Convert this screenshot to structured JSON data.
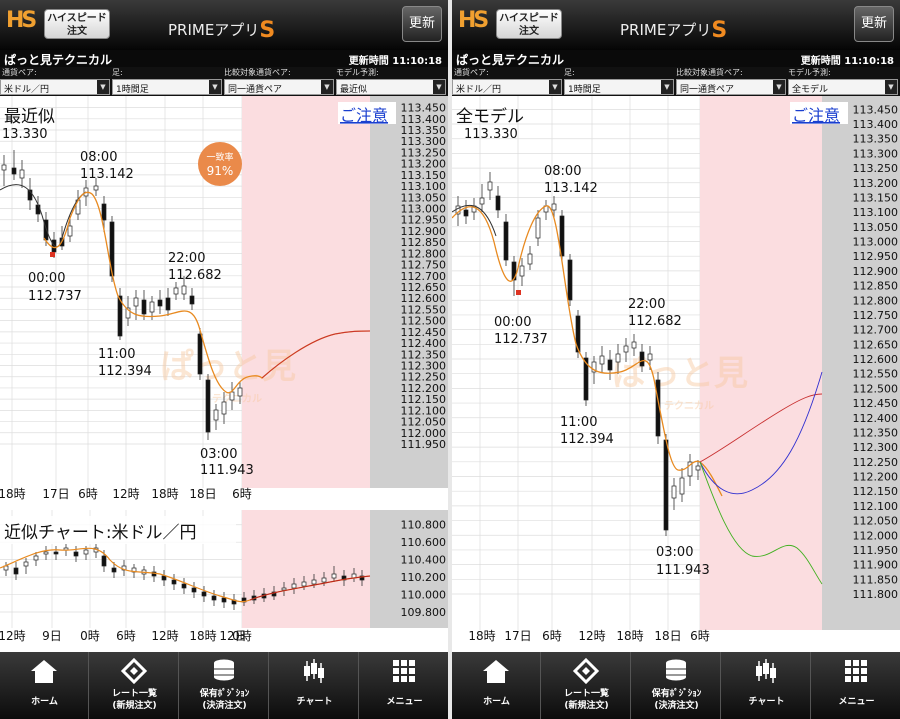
{
  "panels": [
    {
      "header": {
        "logo": "HS",
        "hs_label_1": "ハイスピード",
        "hs_label_2": "注文",
        "brand_text": "PRIMEアプリ",
        "brand_s": "S",
        "update_button": "更新"
      },
      "title_bar": {
        "title": "ぱっと見テクニカル",
        "update_time": "更新時間 11:10:18"
      },
      "controls": {
        "labels": [
          "通貨ペア:",
          "足:",
          "比較対象通貨ペア:",
          "モデル予測:"
        ],
        "values": [
          "米ドル／円",
          "1時間足",
          "同一通貨ペア",
          "最近似"
        ]
      },
      "main_chart": {
        "heading": "最近似",
        "notice_link": "ご注意",
        "match_label": "一致率",
        "match_value": "91%",
        "price_labels": [
          "113.450",
          "113.400",
          "113.350",
          "113.300",
          "113.250",
          "113.200",
          "113.150",
          "113.100",
          "113.050",
          "113.000",
          "112.950",
          "112.900",
          "112.850",
          "112.800",
          "112.750",
          "112.700",
          "112.650",
          "112.600",
          "112.550",
          "112.500",
          "112.450",
          "112.400",
          "112.350",
          "112.300",
          "112.250",
          "112.200",
          "112.150",
          "112.100",
          "112.050",
          "112.000",
          "111.950"
        ],
        "time_labels": [
          "18時",
          "17日",
          "6時",
          "12時",
          "18時",
          "18日",
          "6時"
        ],
        "annotations": [
          {
            "time": "",
            "price": "13.330"
          },
          {
            "time": "08:00",
            "price": "113.142"
          },
          {
            "time": "00:00",
            "price": "112.737"
          },
          {
            "time": "22:00",
            "price": "112.682"
          },
          {
            "time": "11:00",
            "price": "112.394"
          },
          {
            "time": "03:00",
            "price": "111.943"
          }
        ],
        "watermark": "ぱっと見",
        "watermark_sub": "テクニカル"
      },
      "sub_chart": {
        "heading": "近似チャート:米ドル／円",
        "price_labels": [
          "110.800",
          "110.600",
          "110.400",
          "110.200",
          "110.000",
          "109.800"
        ],
        "time_labels": [
          "12時",
          "9日",
          "0時",
          "6時",
          "12時",
          "18時",
          "12日",
          "0時"
        ]
      },
      "tabs": [
        {
          "line1": "ホーム",
          "line2": "",
          "icon": "home-icon"
        },
        {
          "line1": "レート一覧",
          "line2": "(新規注文)",
          "icon": "rate-list-icon"
        },
        {
          "line1": "保有ﾎﾟｼﾞｼｮﾝ",
          "line2": "(決済注文)",
          "icon": "coin-stack-icon"
        },
        {
          "line1": "チャート",
          "line2": "",
          "icon": "candlestick-icon"
        },
        {
          "line1": "メニュー",
          "line2": "",
          "icon": "grid-menu-icon"
        }
      ]
    },
    {
      "header": {
        "logo": "HS",
        "hs_label_1": "ハイスピード",
        "hs_label_2": "注文",
        "brand_text": "PRIMEアプリ",
        "brand_s": "S",
        "update_button": "更新"
      },
      "title_bar": {
        "title": "ぱっと見テクニカル",
        "update_time": "更新時間 11:10:18"
      },
      "controls": {
        "labels": [
          "通貨ペア:",
          "足:",
          "比較対象通貨ペア:",
          "モデル予測:"
        ],
        "values": [
          "米ドル／円",
          "1時間足",
          "同一通貨ペア",
          "全モデル"
        ]
      },
      "main_chart": {
        "heading": "全モデル",
        "notice_link": "ご注意",
        "price_labels": [
          "113.450",
          "113.400",
          "113.350",
          "113.300",
          "113.250",
          "113.200",
          "113.150",
          "113.100",
          "113.050",
          "113.000",
          "112.950",
          "112.900",
          "112.850",
          "112.800",
          "112.750",
          "112.700",
          "112.650",
          "112.600",
          "112.550",
          "112.500",
          "112.450",
          "112.400",
          "112.350",
          "112.300",
          "112.250",
          "112.200",
          "112.150",
          "112.100",
          "112.050",
          "112.000",
          "111.950",
          "111.900",
          "111.850",
          "111.800"
        ],
        "time_labels": [
          "18時",
          "17日",
          "6時",
          "12時",
          "18時",
          "18日",
          "6時"
        ],
        "annotations": [
          {
            "time": "",
            "price": "113.330"
          },
          {
            "time": "08:00",
            "price": "113.142"
          },
          {
            "time": "00:00",
            "price": "112.737"
          },
          {
            "time": "22:00",
            "price": "112.682"
          },
          {
            "time": "11:00",
            "price": "112.394"
          },
          {
            "time": "03:00",
            "price": "111.943"
          }
        ],
        "watermark": "ぱっと見",
        "watermark_sub": "テクニカル"
      },
      "tabs": [
        {
          "line1": "ホーム",
          "line2": "",
          "icon": "home-icon"
        },
        {
          "line1": "レート一覧",
          "line2": "(新規注文)",
          "icon": "rate-list-icon"
        },
        {
          "line1": "保有ﾎﾟｼﾞｼｮﾝ",
          "line2": "(決済注文)",
          "icon": "coin-stack-icon"
        },
        {
          "line1": "チャート",
          "line2": "",
          "icon": "candlestick-icon"
        },
        {
          "line1": "メニュー",
          "line2": "",
          "icon": "grid-menu-icon"
        }
      ]
    }
  ]
}
